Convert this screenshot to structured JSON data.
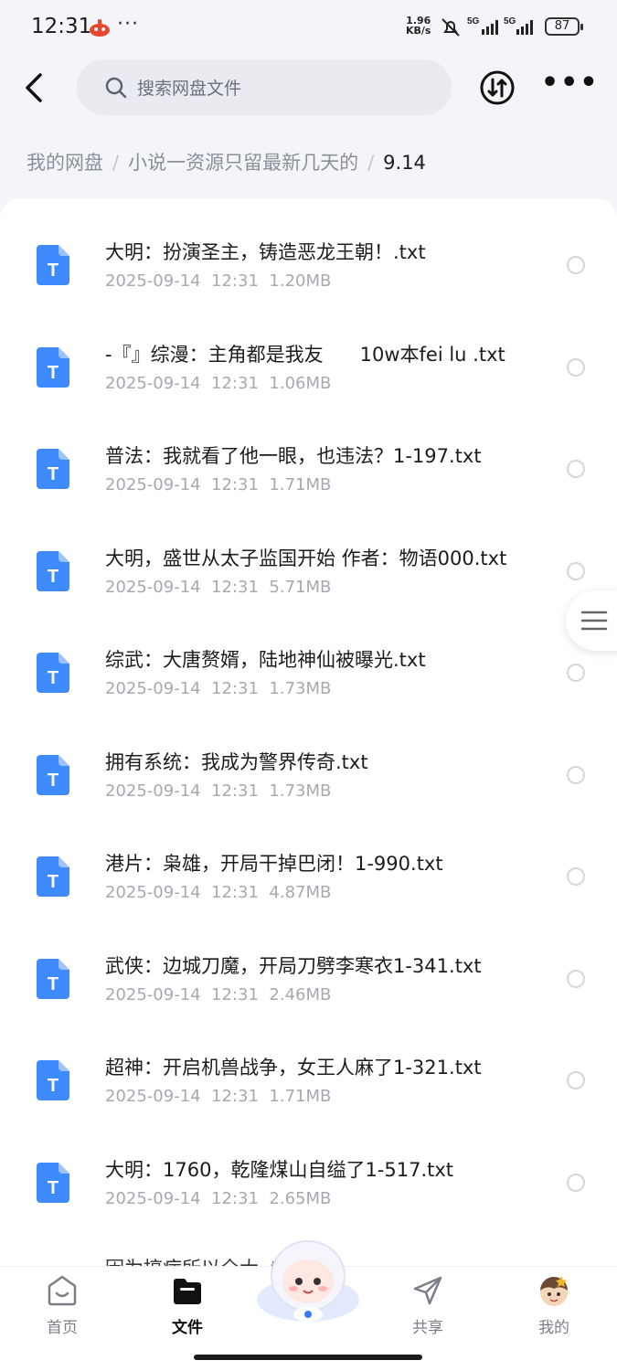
{
  "status_bar": {
    "time": "12:31",
    "speed_value": "1.96",
    "speed_unit": "KB/s",
    "network_1": "5G",
    "network_2": "5G",
    "battery": "87"
  },
  "search": {
    "placeholder": "搜索网盘文件"
  },
  "breadcrumb": {
    "items": [
      "我的网盘",
      "小说一资源只留最新几天的"
    ],
    "current": "9.14"
  },
  "files": [
    {
      "name": "大明：扮演圣主，铸造恶龙王朝！.txt",
      "date": "2025-09-14",
      "time": "12:31",
      "size": "1.20MB",
      "icon": "txt-file-icon"
    },
    {
      "name": "-『』综漫：主角都是我友      10w本fei lu .txt",
      "date": "2025-09-14",
      "time": "12:31",
      "size": "1.06MB",
      "icon": "txt-file-icon"
    },
    {
      "name": "普法：我就看了他一眼，也违法？1-197.txt",
      "date": "2025-09-14",
      "time": "12:31",
      "size": "1.71MB",
      "icon": "txt-file-icon"
    },
    {
      "name": "大明，盛世从太子监国开始 作者：物语000.txt",
      "date": "2025-09-14",
      "time": "12:31",
      "size": "5.71MB",
      "icon": "txt-file-icon"
    },
    {
      "name": "综武：大唐赘婿，陆地神仙被曝光.txt",
      "date": "2025-09-14",
      "time": "12:31",
      "size": "1.73MB",
      "icon": "txt-file-icon"
    },
    {
      "name": "拥有系统：我成为警界传奇.txt",
      "date": "2025-09-14",
      "time": "12:31",
      "size": "1.73MB",
      "icon": "txt-file-icon"
    },
    {
      "name": "港片：枭雄，开局干掉巴闭！1-990.txt",
      "date": "2025-09-14",
      "time": "12:31",
      "size": "4.87MB",
      "icon": "txt-file-icon"
    },
    {
      "name": "武侠：边城刀魔，开局刀劈李寒衣1-341.txt",
      "date": "2025-09-14",
      "time": "12:31",
      "size": "2.46MB",
      "icon": "txt-file-icon"
    },
    {
      "name": "超神：开启机兽战争，女王人麻了1-321.txt",
      "date": "2025-09-14",
      "time": "12:31",
      "size": "1.71MB",
      "icon": "txt-file-icon"
    },
    {
      "name": "大明：1760，乾隆煤山自缢了1-517.txt",
      "date": "2025-09-14",
      "time": "12:31",
      "size": "2.65MB",
      "icon": "txt-file-icon"
    }
  ],
  "partial_row_text": "因为搞病所以全大   .txt",
  "tabs": [
    {
      "label": "首页",
      "icon": "home-smile-icon"
    },
    {
      "label": "文件",
      "icon": "folder-icon",
      "active": true
    },
    {
      "label": "共享",
      "icon": "send-icon"
    },
    {
      "label": "我的",
      "icon": "avatar-icon"
    }
  ],
  "colors": {
    "accent": "#3a7bff",
    "file_icon": "#3d8bff",
    "background": "#f4f5f8"
  }
}
